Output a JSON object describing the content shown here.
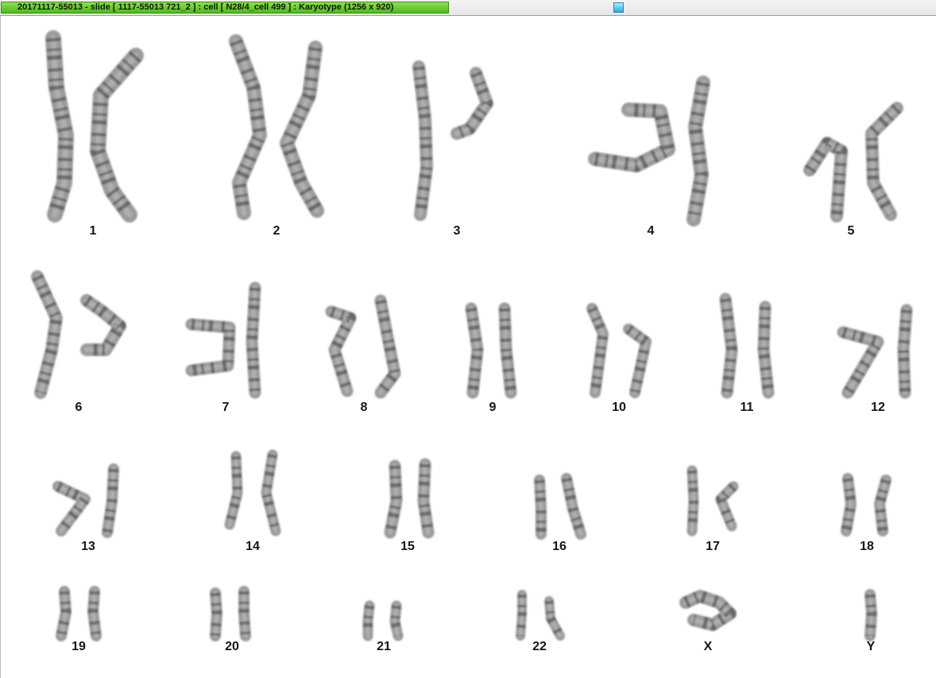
{
  "window": {
    "title": "20171117-55013 - slide [ 1117-55013 721_2 ] : cell [ N28/4_cell 499 ] : Karyotype  (1256 x 920)"
  },
  "colors": {
    "title_tab_green": "#5cc628",
    "scroll_thumb_cyan": "#2aa9e3",
    "chromatid_gray": "#8a8a8a",
    "band_dark": "#3a3a3a"
  },
  "karyotype": {
    "chromosomes": [
      {
        "label": "1"
      },
      {
        "label": "2"
      },
      {
        "label": "3"
      },
      {
        "label": "4"
      },
      {
        "label": "5"
      },
      {
        "label": "6"
      },
      {
        "label": "7"
      },
      {
        "label": "8"
      },
      {
        "label": "9"
      },
      {
        "label": "10"
      },
      {
        "label": "11"
      },
      {
        "label": "12"
      },
      {
        "label": "13"
      },
      {
        "label": "14"
      },
      {
        "label": "15"
      },
      {
        "label": "16"
      },
      {
        "label": "17"
      },
      {
        "label": "18"
      },
      {
        "label": "19"
      },
      {
        "label": "20"
      },
      {
        "label": "21"
      },
      {
        "label": "22"
      },
      {
        "label": "X"
      },
      {
        "label": "Y"
      }
    ]
  }
}
